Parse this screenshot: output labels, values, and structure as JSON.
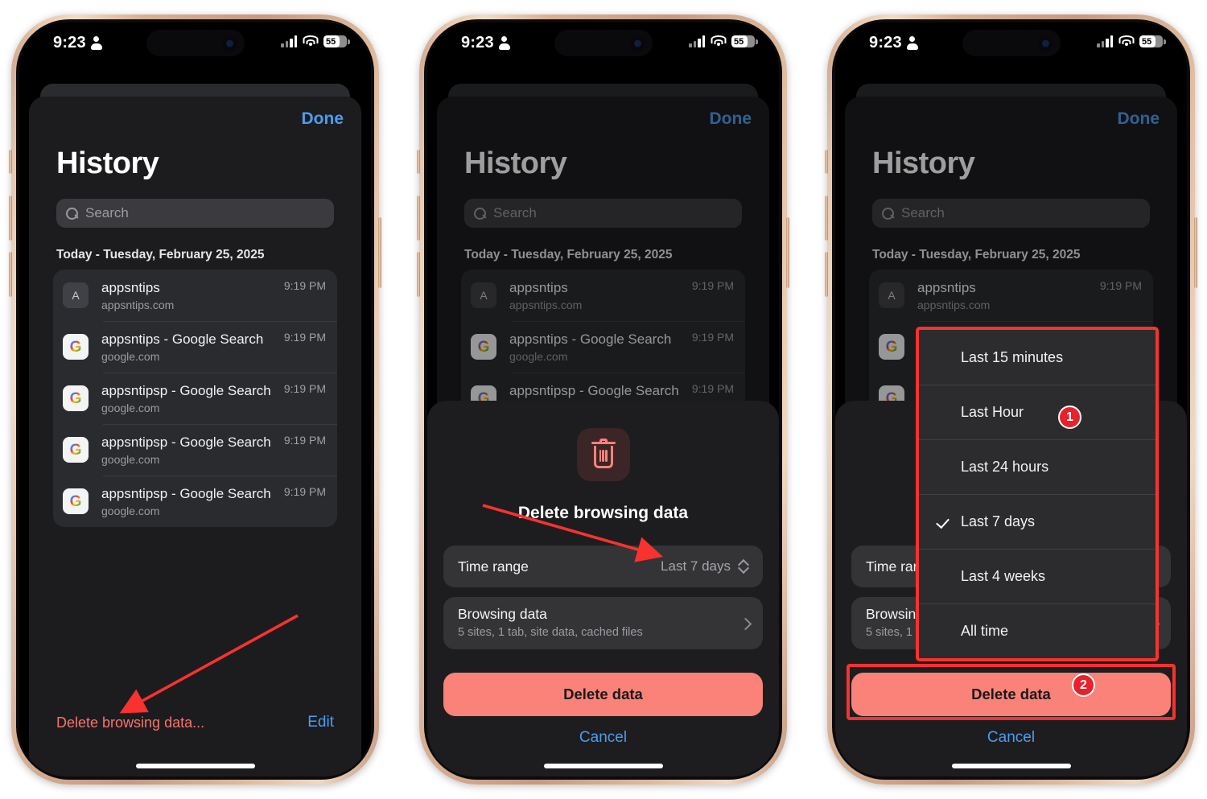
{
  "status_bar": {
    "time": "9:23",
    "battery_percent": "55",
    "icons": [
      "person-icon",
      "cellular-signal-icon",
      "wifi-icon",
      "battery-icon"
    ]
  },
  "header": {
    "done_label": "Done",
    "title": "History"
  },
  "search": {
    "placeholder": "Search"
  },
  "day_header": "Today - Tuesday, February 25, 2025",
  "history": [
    {
      "favicon": "A",
      "type": "letter",
      "title": "appsntips",
      "site": "appsntips.com",
      "time": "9:19 PM"
    },
    {
      "favicon": "G",
      "type": "google",
      "title": "appsntips - Google Search",
      "site": "google.com",
      "time": "9:19 PM"
    },
    {
      "favicon": "G",
      "type": "google",
      "title": "appsntipsp - Google Search",
      "site": "google.com",
      "time": "9:19 PM"
    },
    {
      "favicon": "G",
      "type": "google",
      "title": "appsntipsp - Google Search",
      "site": "google.com",
      "time": "9:19 PM"
    },
    {
      "favicon": "G",
      "type": "google",
      "title": "appsntipsp - Google Search",
      "site": "google.com",
      "time": "9:19 PM"
    }
  ],
  "bottom_bar": {
    "delete_link": "Delete browsing data...",
    "edit_link": "Edit"
  },
  "delete_sheet": {
    "icon": "trash-icon",
    "title": "Delete browsing data",
    "time_range_label": "Time range",
    "time_range_value": "Last 7 days",
    "browsing_data_label": "Browsing data",
    "browsing_data_sub": "5 sites, 1 tab, site data, cached files",
    "delete_button": "Delete data",
    "cancel_button": "Cancel"
  },
  "time_range_menu": {
    "options": [
      {
        "label": "Last 15 minutes",
        "checked": false
      },
      {
        "label": "Last Hour",
        "checked": false
      },
      {
        "label": "Last 24 hours",
        "checked": false
      },
      {
        "label": "Last 7 days",
        "checked": true
      },
      {
        "label": "Last 4 weeks",
        "checked": false
      },
      {
        "label": "All time",
        "checked": false
      }
    ]
  },
  "annotations": {
    "step_one": "1",
    "step_two": "2",
    "accent_color": "#f8322f"
  },
  "colors": {
    "accent_blue": "#4a9df0",
    "danger": "#fa8279",
    "sheet_bg": "#1d1d1f",
    "row_bg": "#2a2b2e"
  }
}
